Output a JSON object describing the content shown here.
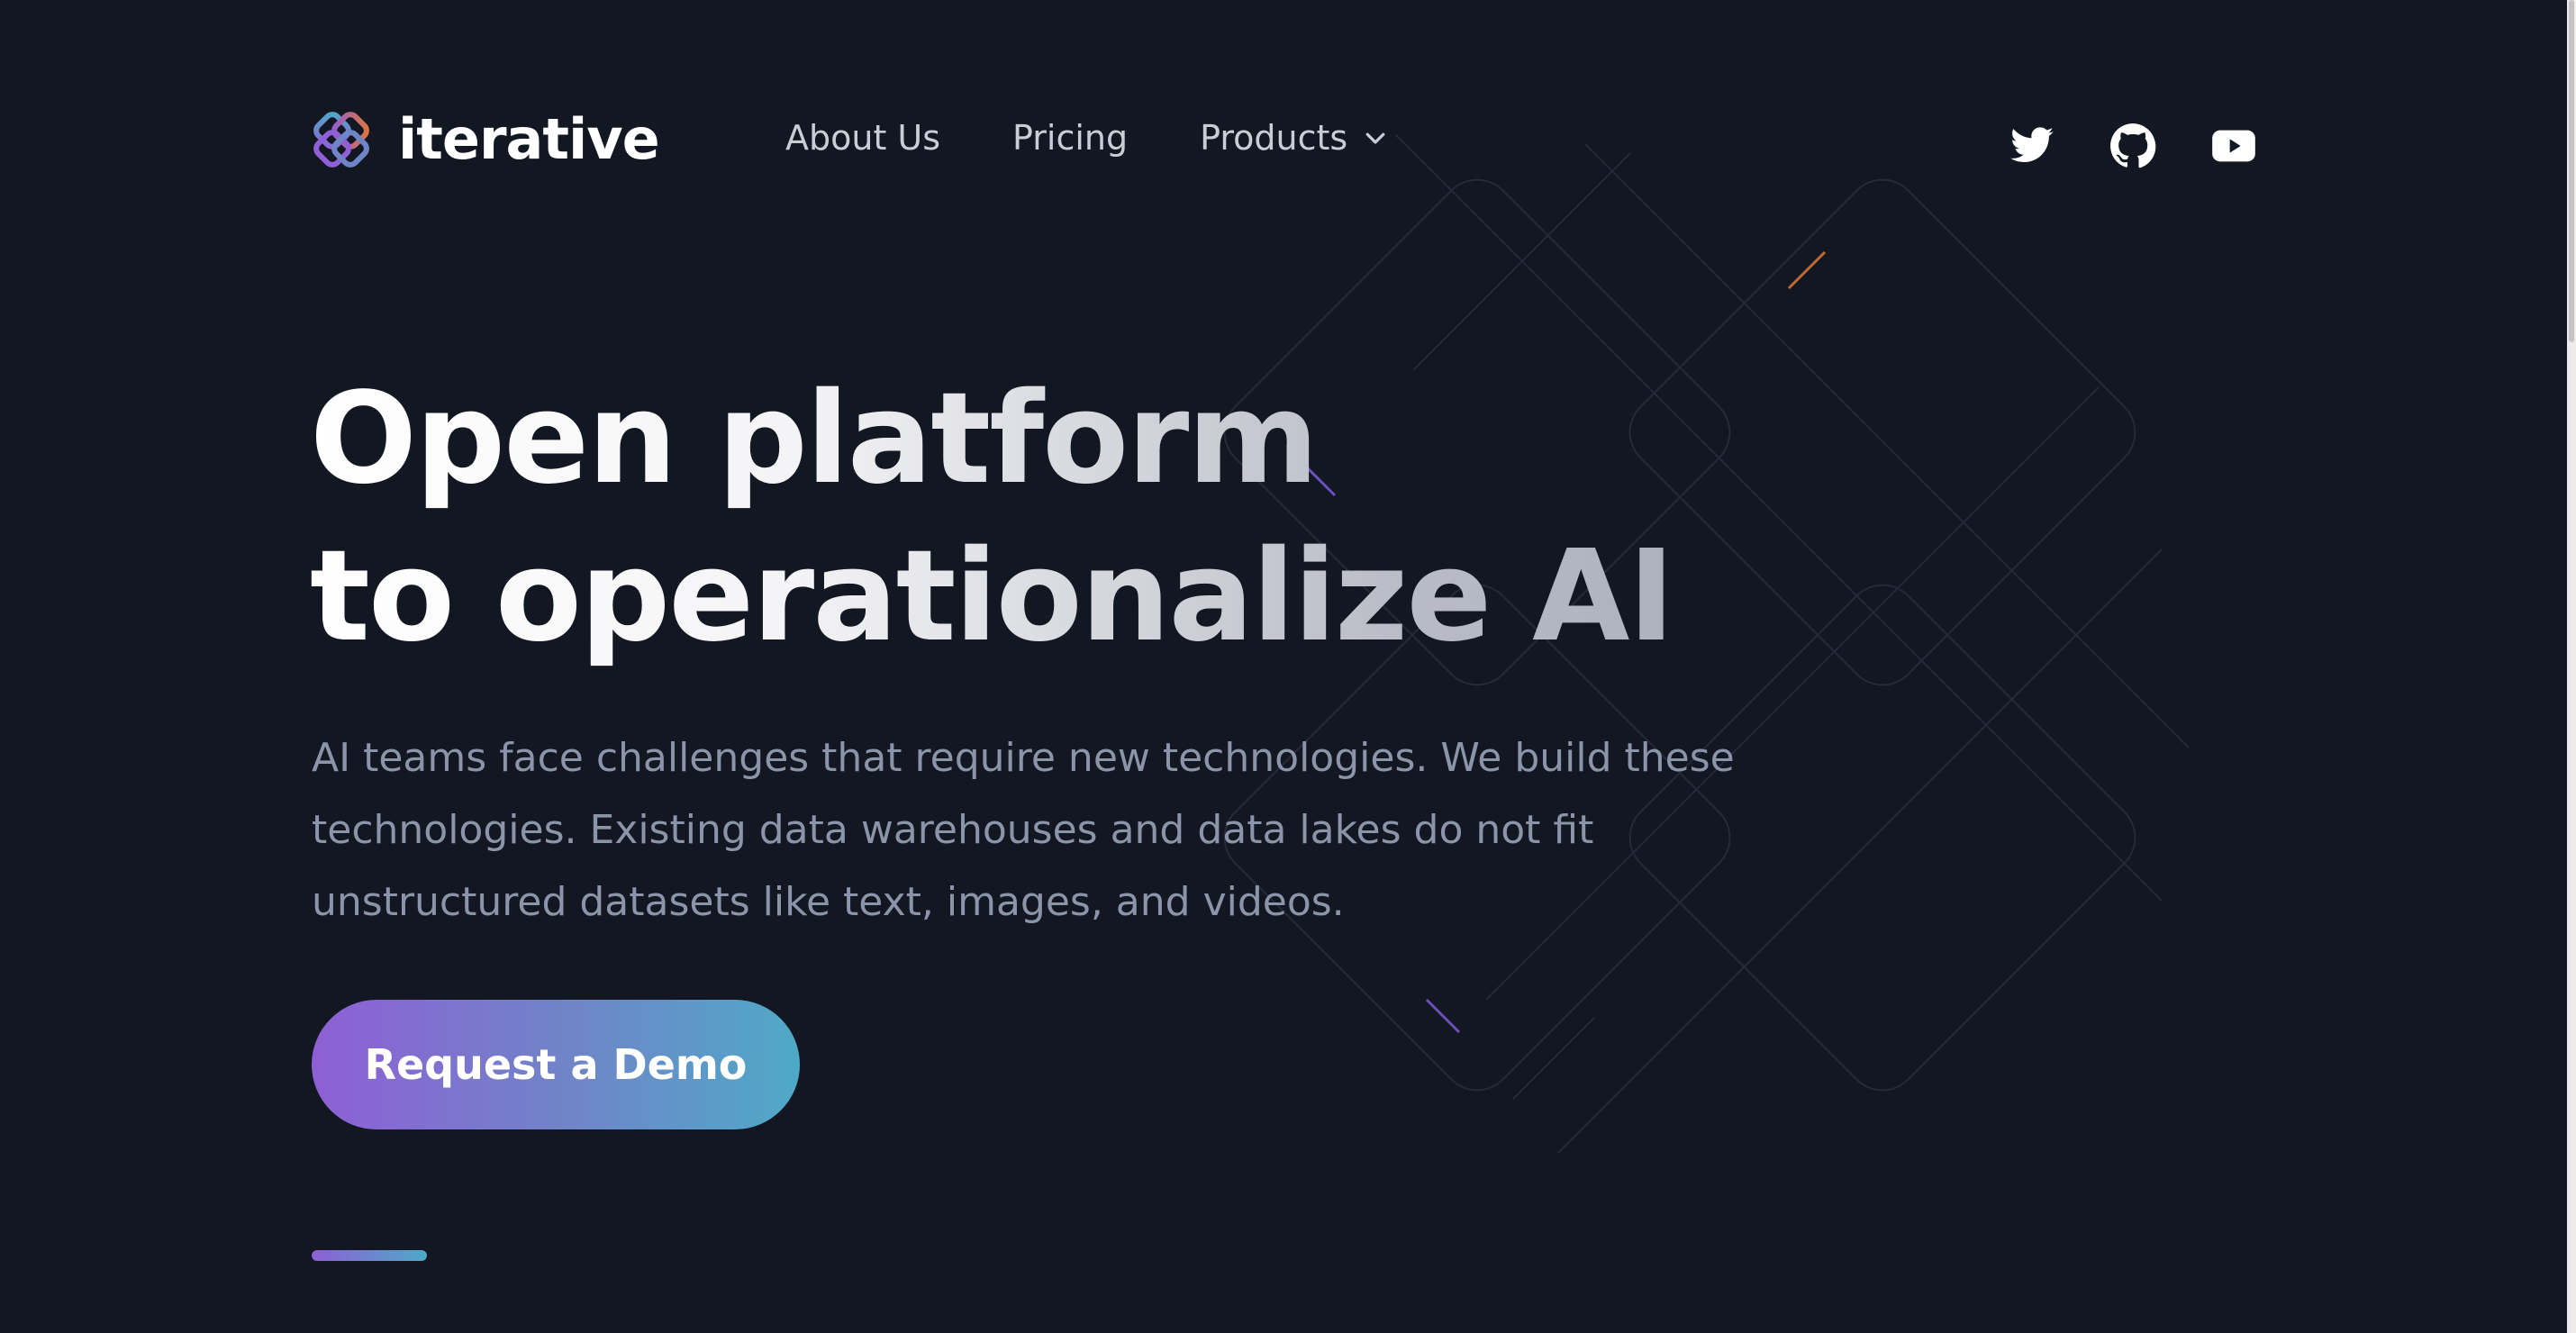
{
  "brand": {
    "name": "iterative",
    "logo_icon": "iterative-logo-icon"
  },
  "nav": {
    "items": [
      {
        "label": "About Us"
      },
      {
        "label": "Pricing"
      },
      {
        "label": "Products",
        "has_dropdown": true
      }
    ]
  },
  "social": [
    {
      "icon": "twitter-icon"
    },
    {
      "icon": "github-icon"
    },
    {
      "icon": "youtube-icon"
    }
  ],
  "hero": {
    "title_line1": "Open platform",
    "title_line2": "to operationalize AI",
    "description": "AI teams face challenges that require new technologies. We build these technologies. Existing data warehouses and data lakes do not fit unstructured datasets like text, images, and videos.",
    "cta_label": "Request a Demo"
  },
  "colors": {
    "background": "#121722",
    "accent_purple": "#8e5fd6",
    "accent_teal": "#4fa9c7",
    "text_muted": "#8b94a8",
    "nav_text": "#c9cdd6"
  }
}
